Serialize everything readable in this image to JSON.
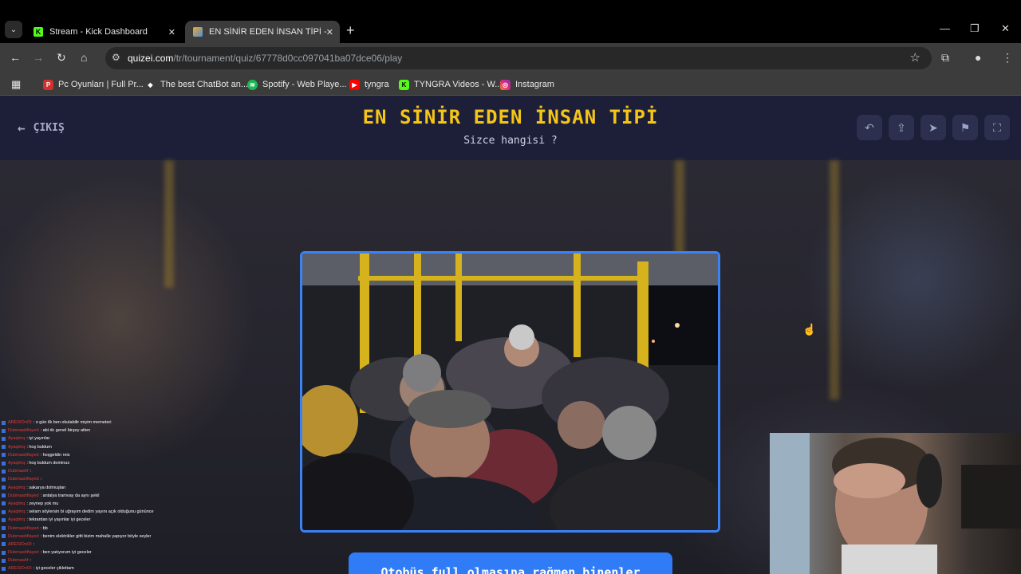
{
  "browser": {
    "tabs": [
      {
        "title": "Stream - Kick Dashboard",
        "favicon": "kick-icon",
        "active": false
      },
      {
        "title": "EN SİNİR EDEN İNSAN TİPİ - Qu",
        "favicon": "quizei-icon",
        "active": true
      }
    ],
    "url_domain": "quizei.com",
    "url_path": "/tr/tournament/quiz/67778d0cc097041ba07dce06/play",
    "bookmarks": [
      {
        "label": "Pc Oyunları | Full Pr...",
        "icon": "pc-oyunlari-icon"
      },
      {
        "label": "The best ChatBot an...",
        "icon": "chatbot-icon"
      },
      {
        "label": "Spotify - Web Playe...",
        "icon": "spotify-icon"
      },
      {
        "label": "tyngra",
        "icon": "youtube-icon"
      },
      {
        "label": "TYNGRA Videos - W...",
        "icon": "kick-icon"
      },
      {
        "label": "Instagram",
        "icon": "instagram-icon"
      }
    ]
  },
  "quiz": {
    "exit_label": "ÇIKIŞ",
    "title": "EN SİNİR EDEN İNSAN TİPİ",
    "subtitle": "Sizce hangisi ?",
    "option_label": "Otobüs full olmasına rağmen binenler",
    "accent": "#f5c518",
    "button_color": "#2f7cf6"
  },
  "chat": [
    {
      "user": "ARESIOnOI",
      "msg": ": o gün ilk ben okulabilir miyim memeteri"
    },
    {
      "user": "Dubmaahflayed",
      "msg": ": abi dc genel birşey atten"
    },
    {
      "user": "Ayaqlmq",
      "msg": ": iyi yayınlar"
    },
    {
      "user": "Ayaqlmq",
      "msg": ": hoş buldum"
    },
    {
      "user": "Dubmaahflayed",
      "msg": ": hoşgeldin reis"
    },
    {
      "user": "Ayaqlmq",
      "msg": ": hoş buldum dominus"
    },
    {
      "user": "Dubmaahf",
      "msg": ":"
    },
    {
      "user": "Dubmaahflayed",
      "msg": ":"
    },
    {
      "user": "Ayaqlmq",
      "msg": ": sakarya dolmuşları"
    },
    {
      "user": "Dubmaahflayed",
      "msg": ": antalya tramvay da aynı şekil"
    },
    {
      "user": "Ayaqlmq",
      "msg": ": zeynep yok mu"
    },
    {
      "user": "Ayaqlmq",
      "msg": ": selam söylersin bi uğrayım dedim yayını açık olduğunu gününce"
    },
    {
      "user": "Ayaqlmq",
      "msg": ": tekrardan iyi yayınlar iyi geceler"
    },
    {
      "user": "Dubmaahflayed",
      "msg": ": bb"
    },
    {
      "user": "Dubmaahflayed",
      "msg": ": benim elektrikler gitti bizim mahalle yapıyor böyle seyler"
    },
    {
      "user": "ARESIOnOI",
      "msg": ":"
    },
    {
      "user": "Dubmaahflayed",
      "msg": ": ben yatıyorum iyi geceler"
    },
    {
      "user": "Dubmaahf",
      "msg": ":"
    },
    {
      "user": "ARESIOnOI",
      "msg": ": iyi geceler çiklettam"
    }
  ]
}
